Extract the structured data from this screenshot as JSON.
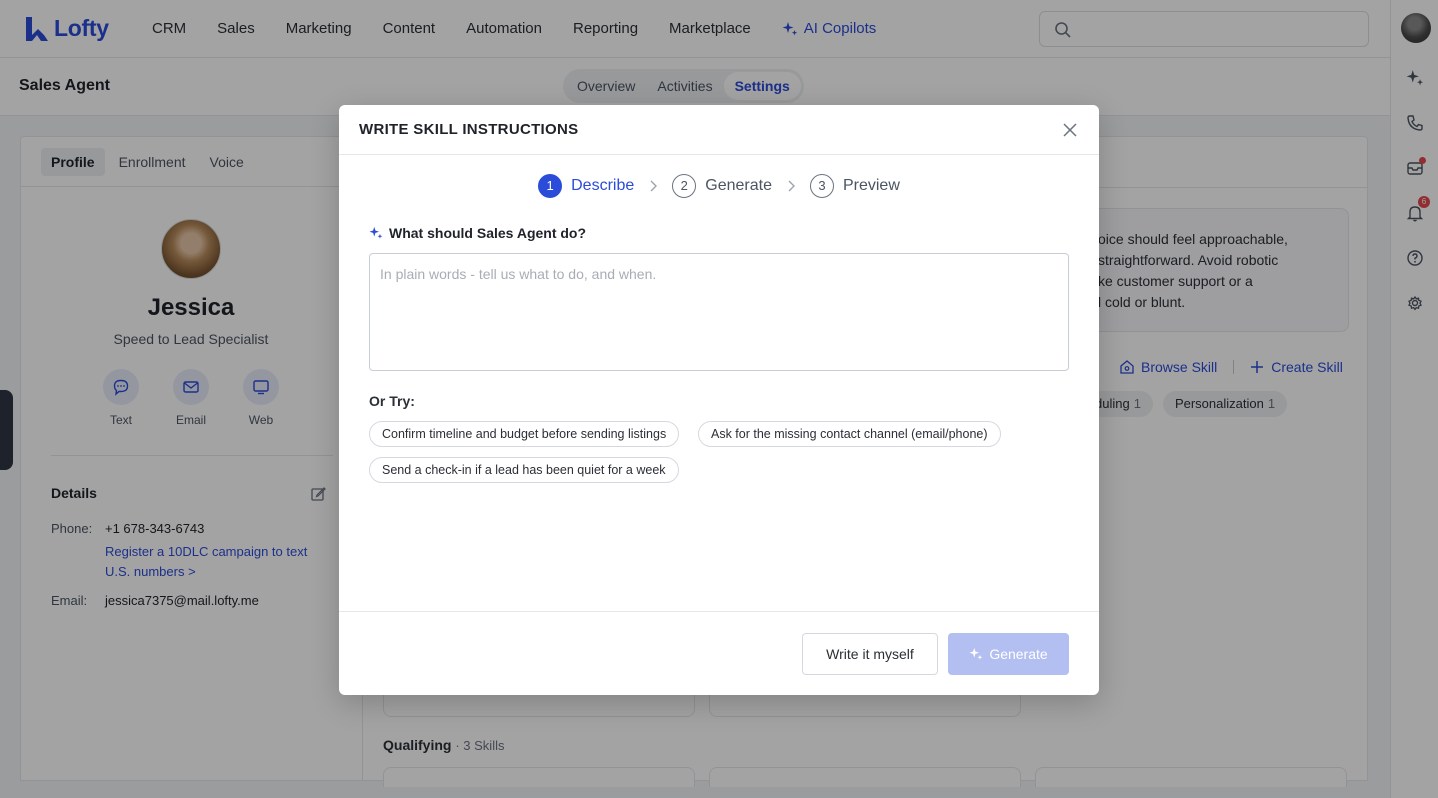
{
  "brand": {
    "name": "Lofty",
    "accent": "#2b4cd9"
  },
  "nav": {
    "items": [
      "CRM",
      "Sales",
      "Marketing",
      "Content",
      "Automation",
      "Reporting",
      "Marketplace"
    ],
    "ai_label": "AI Copilots",
    "search_placeholder": ""
  },
  "rail": {
    "notification_count": "6"
  },
  "subheader": {
    "title": "Sales Agent",
    "tabs": [
      {
        "label": "Overview",
        "active": false
      },
      {
        "label": "Activities",
        "active": false
      },
      {
        "label": "Settings",
        "active": true
      }
    ]
  },
  "profile": {
    "tabs": [
      "Profile",
      "Enrollment",
      "Voice"
    ],
    "name": "Jessica",
    "role": "Speed to Lead Specialist",
    "channels": [
      {
        "label": "Text",
        "icon": "chat-icon"
      },
      {
        "label": "Email",
        "icon": "mail-icon"
      },
      {
        "label": "Web",
        "icon": "monitor-icon"
      }
    ],
    "details_title": "Details",
    "phone_label": "Phone:",
    "phone_value": "+1 678-343-6743",
    "phone_link": "Register a 10DLC campaign to text U.S. numbers >",
    "email_label": "Email:",
    "email_value": "jessica7375@mail.lofty.me"
  },
  "main": {
    "voice_lines": [
      "oice should feel approachable,",
      "straightforward. Avoid robotic",
      "ke customer support or a",
      "l cold or blunt."
    ],
    "browse_skill": "Browse Skill",
    "create_skill": "Create Skill",
    "chips": [
      {
        "label": "duling",
        "count": "1"
      },
      {
        "label": "Personalization",
        "count": "1"
      }
    ],
    "qualifying_label": "Qualifying",
    "qualifying_count": "3 Skills"
  },
  "modal": {
    "title": "WRITE SKILL INSTRUCTIONS",
    "steps": [
      {
        "num": "1",
        "label": "Describe",
        "active": true
      },
      {
        "num": "2",
        "label": "Generate",
        "active": false
      },
      {
        "num": "3",
        "label": "Preview",
        "active": false
      }
    ],
    "question": "What should Sales Agent do?",
    "placeholder": "In plain words - tell us what to do, and when.",
    "or_try": "Or Try:",
    "suggestions": [
      "Confirm timeline and budget before sending listings",
      "Ask for the missing contact channel (email/phone)",
      "Send a check-in if a lead has been quiet for a week"
    ],
    "write_myself": "Write it myself",
    "generate": "Generate"
  }
}
